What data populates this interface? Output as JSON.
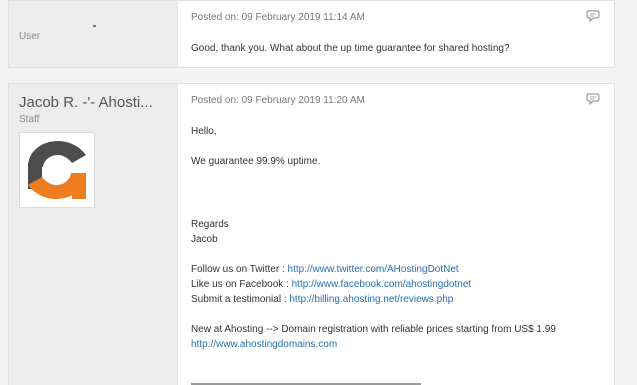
{
  "posts": [
    {
      "author_name": "",
      "author_role": "User",
      "posted": "Posted on: 09 February 2019 11:14 AM",
      "message": "Good, thank you. What about the up time guarantee for shared hosting?"
    },
    {
      "author_name": "Jacob R. -'- Ahosti...",
      "author_role": "Staff",
      "posted": "Posted on: 09 February 2019 11:20 AM",
      "greeting": "Hello,",
      "statement": "We guarantee 99.9% uptime.",
      "regards": "Regards",
      "signature_name": "Jacob",
      "twitter_label": "Follow us on Twitter : ",
      "twitter_url": "http://www.twitter.com/AHostingDotNet",
      "facebook_label": "Like us on Facebook : ",
      "facebook_url": "http://www.facebook.com/ahostingdotnet",
      "testimonial_label": "Submit a testimonial : ",
      "testimonial_url": "http://billing.ahosting.net/reviews.php",
      "promo_text": "New at Ahosting --> Domain registration with reliable prices starting from US$ 1.99",
      "promo_url": "http://www.ahostingdomains.com"
    }
  ],
  "colors": {
    "link": "#2a6fb0",
    "logo_dark": "#4d4d4d",
    "logo_orange": "#ee7d22"
  },
  "icons": {
    "quote": "speech-bubble-icon"
  }
}
